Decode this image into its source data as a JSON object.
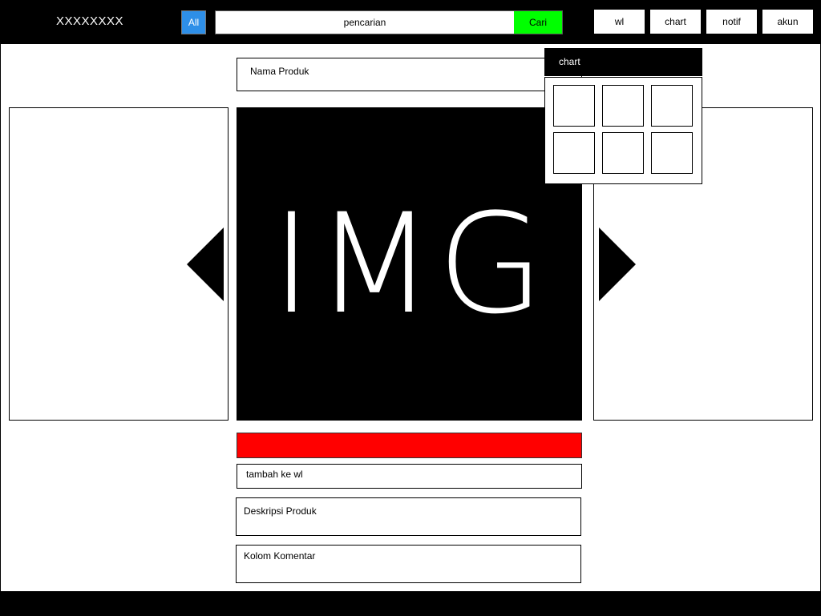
{
  "header": {
    "logo": "XXXXXXXX",
    "category_button": "All",
    "search": {
      "value": "pencarian",
      "button": "Cari"
    },
    "nav": [
      "wl",
      "chart",
      "notif",
      "akun"
    ]
  },
  "product": {
    "name_label": "Nama Produk",
    "image_text": "IMG",
    "wishlist_label": "tambah ke wl",
    "description_label": "Deskripsi Produk",
    "comments_label": "Kolom Komentar"
  },
  "chart_popup": {
    "title": "chart",
    "item_count": 6
  },
  "colors": {
    "background": "#000000",
    "category_button": "#2e8fe8",
    "search_button": "#00ff00",
    "buy_bar": "#ff0000"
  }
}
